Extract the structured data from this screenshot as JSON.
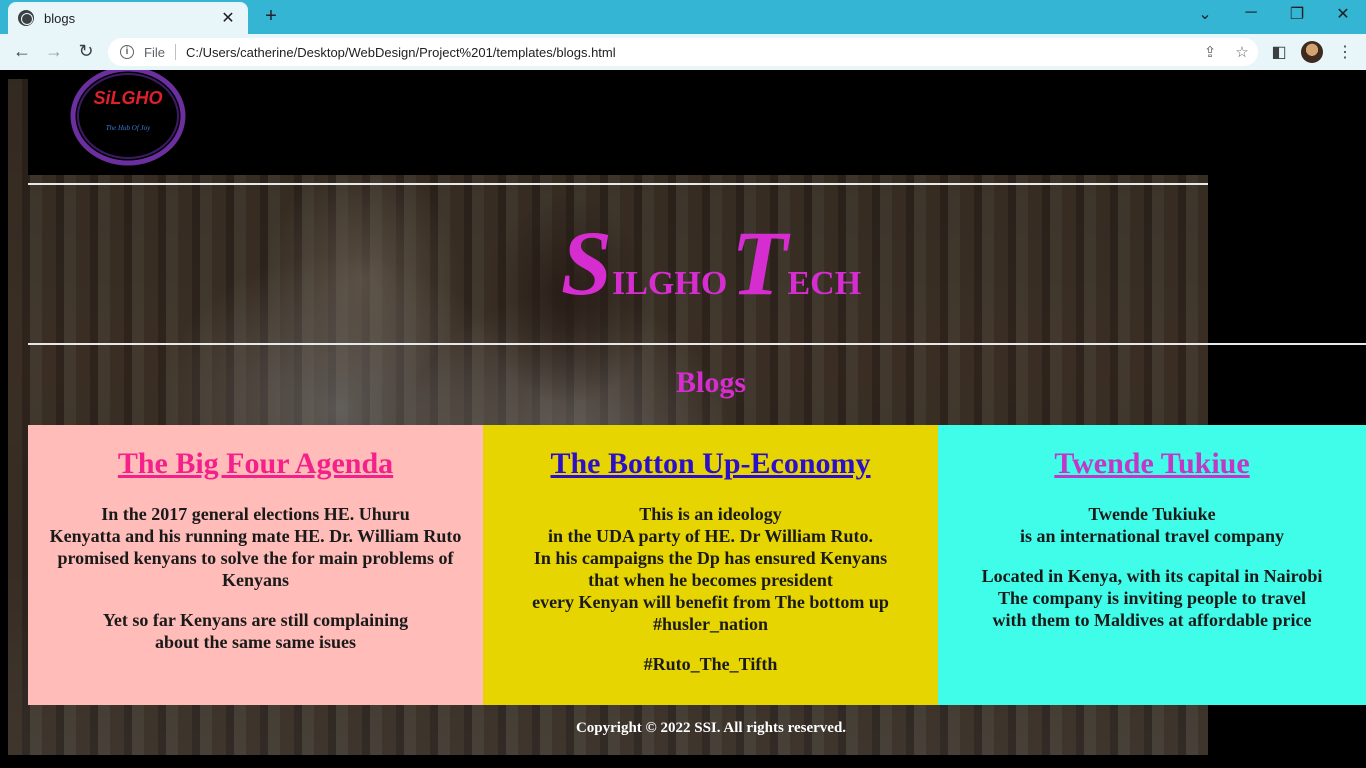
{
  "browser": {
    "tab_title": "blogs",
    "new_tab": "+",
    "file_label": "File",
    "url": "C:/Users/catherine/Desktop/WebDesign/Project%201/templates/blogs.html"
  },
  "site": {
    "title_letter_1": "S",
    "title_rest_1": "ILGHO",
    "title_letter_2": "T",
    "title_rest_2": "ECH",
    "blogs_heading": "Blogs",
    "logo_text": "SiLGHO",
    "logo_tagline": "The Hub Of Joy"
  },
  "cards": [
    {
      "title": "The Big Four Agenda",
      "p1": "In the 2017 general elections HE. Uhuru\nKenyatta and his running mate HE. Dr. William Ruto\npromised kenyans to solve the for main problems of\nKenyans",
      "p2": "Yet so far Kenyans are still complaining\nabout the same same isues"
    },
    {
      "title": "The Botton Up-Economy",
      "p1": "This is an ideology\nin the UDA party of HE. Dr William Ruto.\nIn his campaigns the Dp has ensured Kenyans\nthat when he becomes president\nevery Kenyan will benefit from The bottom up\n#husler_nation",
      "p2": "#Ruto_The_Tifth"
    },
    {
      "title": "Twende Tukiue",
      "p1": "Twende Tukiuke\nis an international travel company",
      "p2": "Located in Kenya, with its capital in Nairobi\nThe company is inviting people to travel\nwith them to Maldives at affordable price"
    }
  ],
  "footer": "Copyright © 2022 SSI. All rights reserved.",
  "colors": {
    "title": "#d62dd0",
    "card1_bg": "#ffbcb8",
    "card2_bg": "#e6d500",
    "card3_bg": "#3ffde8"
  }
}
